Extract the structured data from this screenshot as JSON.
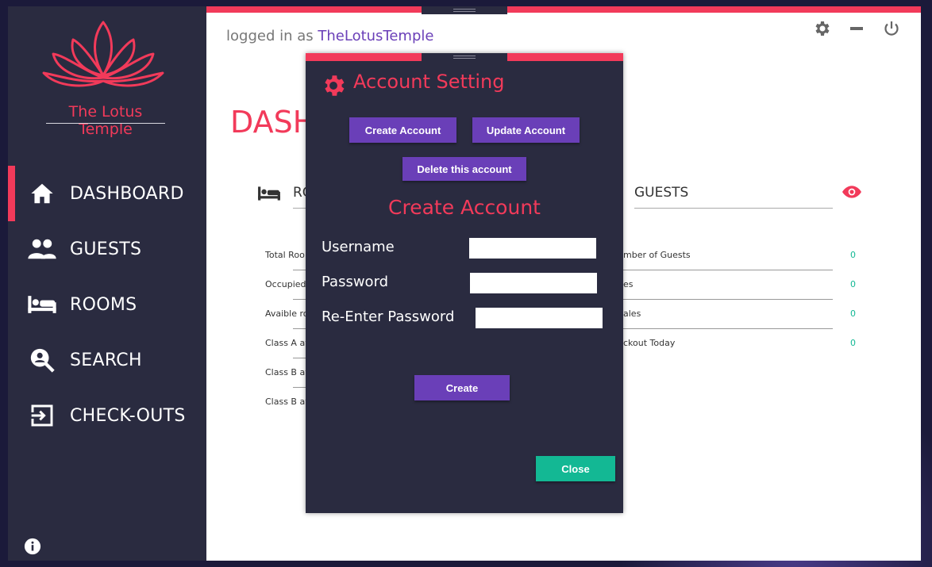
{
  "app": {
    "brand_name": "The Lotus Temple",
    "accent_color": "#f23a5a",
    "purple": "#6a3fb8",
    "green": "#13b894"
  },
  "sidebar": {
    "items": [
      {
        "label": "DASHBOARD",
        "icon": "home-icon",
        "active": true
      },
      {
        "label": "GUESTS",
        "icon": "people-icon"
      },
      {
        "label": "ROOMS",
        "icon": "bed-icon"
      },
      {
        "label": "SEARCH",
        "icon": "search-person-icon"
      },
      {
        "label": "CHECK-OUTS",
        "icon": "exit-icon"
      }
    ],
    "info_icon": "info-icon"
  },
  "header": {
    "logged_prefix": "logged in as",
    "username": "TheLotusTemple"
  },
  "dashboard": {
    "title": "DASH",
    "rooms_card": {
      "title": "RO",
      "stats": [
        "Total Roo",
        "Occupied",
        "Avaible ro",
        "Class A av",
        "Class B av",
        "Class B av"
      ]
    },
    "guests_card": {
      "title": "GUESTS",
      "stats": [
        {
          "label": "mber of Guests",
          "value": "0"
        },
        {
          "label": "es",
          "value": "0"
        },
        {
          "label": "ales",
          "value": "0"
        },
        {
          "label": "ckout Today",
          "value": "0"
        }
      ]
    }
  },
  "dialog": {
    "title": "Account Setting",
    "tabs": {
      "create": "Create Account",
      "update": "Update Account",
      "delete": "Delete this account"
    },
    "section_title": "Create Account",
    "fields": {
      "username_label": "Username",
      "password_label": "Password",
      "reenter_label": "Re-Enter Password",
      "username_value": "",
      "password_value": "",
      "reenter_value": ""
    },
    "create_button": "Create",
    "close_button": "Close"
  }
}
